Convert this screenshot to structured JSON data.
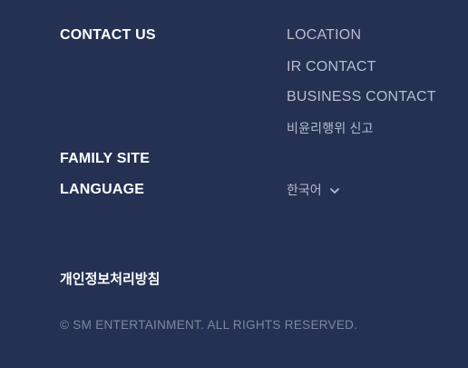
{
  "contact": {
    "heading": "CONTACT US",
    "links": [
      "LOCATION",
      "IR CONTACT",
      "BUSINESS CONTACT",
      "비윤리행위 신고"
    ]
  },
  "family_site": {
    "heading": "FAMILY SITE"
  },
  "language": {
    "heading": "LANGUAGE",
    "selected": "한국어",
    "icon": "chevron-down-icon"
  },
  "privacy_link": "개인정보처리방침",
  "copyright": "© SM ENTERTAINMENT. ALL RIGHTS RESERVED.",
  "colors": {
    "background": "#243153",
    "heading": "#ffffff",
    "link": "#b8bdcc",
    "copyright": "#7f879c"
  }
}
